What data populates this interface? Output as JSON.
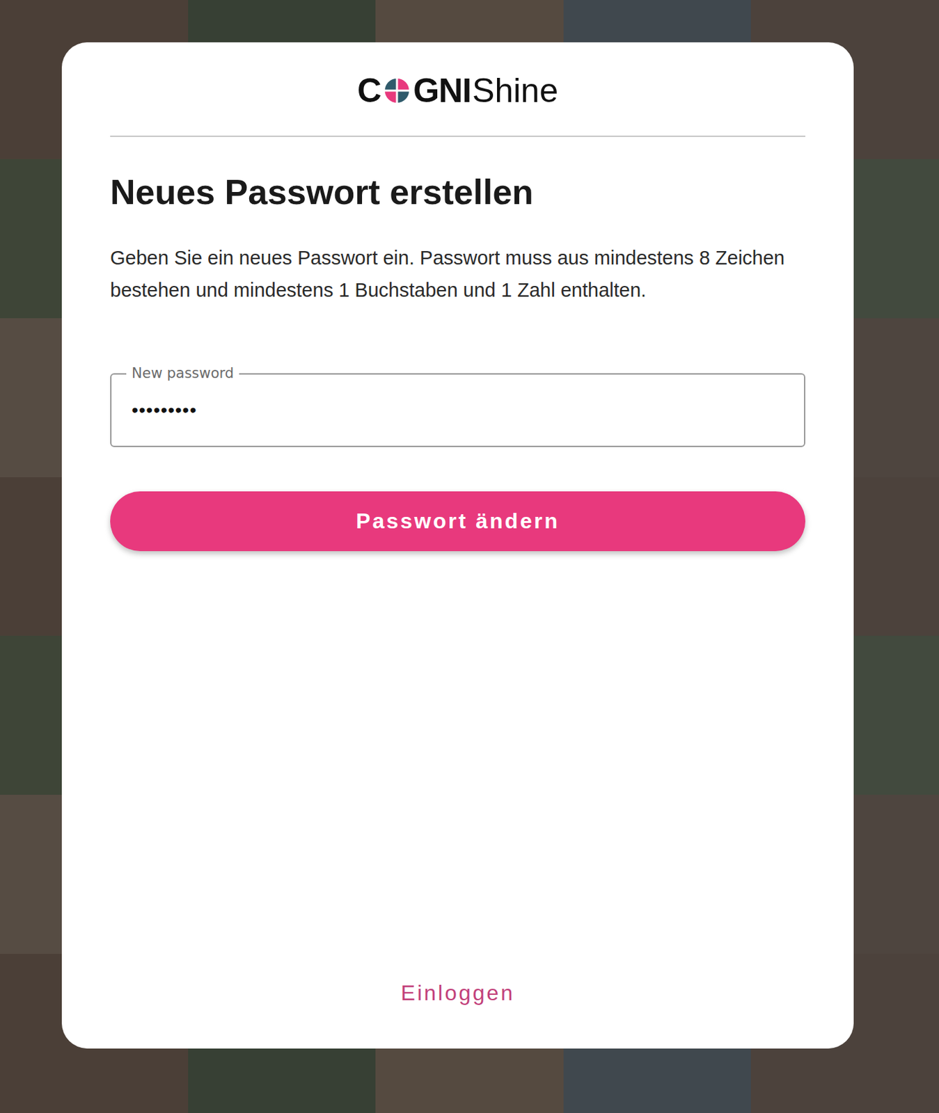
{
  "logo": {
    "prefix": "C",
    "bold": "GNI",
    "light": "Shine"
  },
  "title": "Neues Passwort erstellen",
  "description": "Geben Sie ein neues Passwort ein. Passwort muss aus mindestens 8 Zeichen bestehen und mindestens 1 Buchstaben und 1 Zahl enthalten.",
  "field": {
    "label": "New password",
    "value": "•••••••••"
  },
  "submit": {
    "label": "Passwort ändern"
  },
  "links": [
    {
      "label": "Einloggen"
    }
  ]
}
